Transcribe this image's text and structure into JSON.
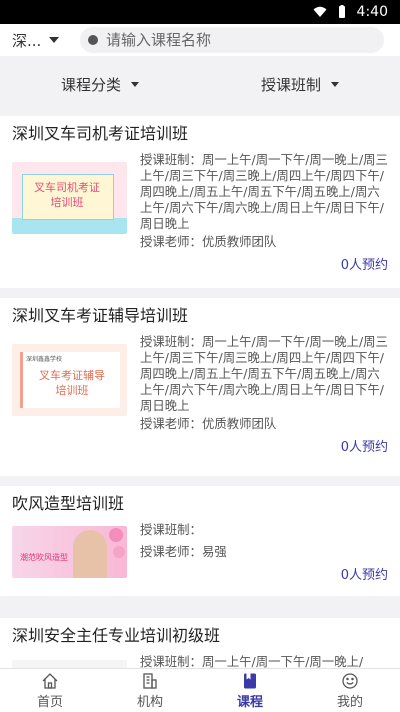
{
  "status_bar": {
    "time": "4:40",
    "icons": [
      "wifi-icon",
      "battery-icon"
    ]
  },
  "search": {
    "city": "深...",
    "placeholder": "请输入课程名称"
  },
  "filters": [
    {
      "label": "课程分类"
    },
    {
      "label": "授课班制"
    }
  ],
  "courses": [
    {
      "title": "深圳叉车司机考证培训班",
      "thumb_text": "叉车司机考证\n培训班",
      "schedule": "授课班制：周一上午/周一下午/周一晚上/周三上午/周三下午/周三晚上/周四上午/周四下午/周四晚上/周五上午/周五下午/周五晚上/周六上午/周六下午/周六晚上/周日上午/周日下午/周日晚上",
      "teacher": "授课老师：优质教师团队",
      "booking": "0人预约"
    },
    {
      "title": "深圳叉车考证辅导培训班",
      "thumb_small": "深圳鑫鑫学校",
      "thumb_text": "叉车考证辅导\n培训班",
      "schedule": "授课班制：周一上午/周一下午/周一晚上/周三上午/周三下午/周三晚上/周四上午/周四下午/周四晚上/周五上午/周五下午/周五晚上/周六上午/周六下午/周六晚上/周日上午/周日下午/周日晚上",
      "teacher": "授课老师：优质教师团队",
      "booking": "0人预约"
    },
    {
      "title": "吹风造型培训班",
      "thumb_text": "潮范吹风造型",
      "schedule": "授课班制：",
      "teacher": "授课老师：易强",
      "booking": "0人预约"
    },
    {
      "title": "深圳安全主任专业培训初级班",
      "schedule": "授课班制：周一上午/周一下午/周一晚上/"
    }
  ],
  "bottom_nav": [
    {
      "label": "首页",
      "icon": "home-icon"
    },
    {
      "label": "机构",
      "icon": "building-icon"
    },
    {
      "label": "课程",
      "icon": "book-icon",
      "active": true
    },
    {
      "label": "我的",
      "icon": "smiley-icon"
    }
  ],
  "colors": {
    "accent": "#3a3aa8",
    "background": "#f2f2f4"
  }
}
